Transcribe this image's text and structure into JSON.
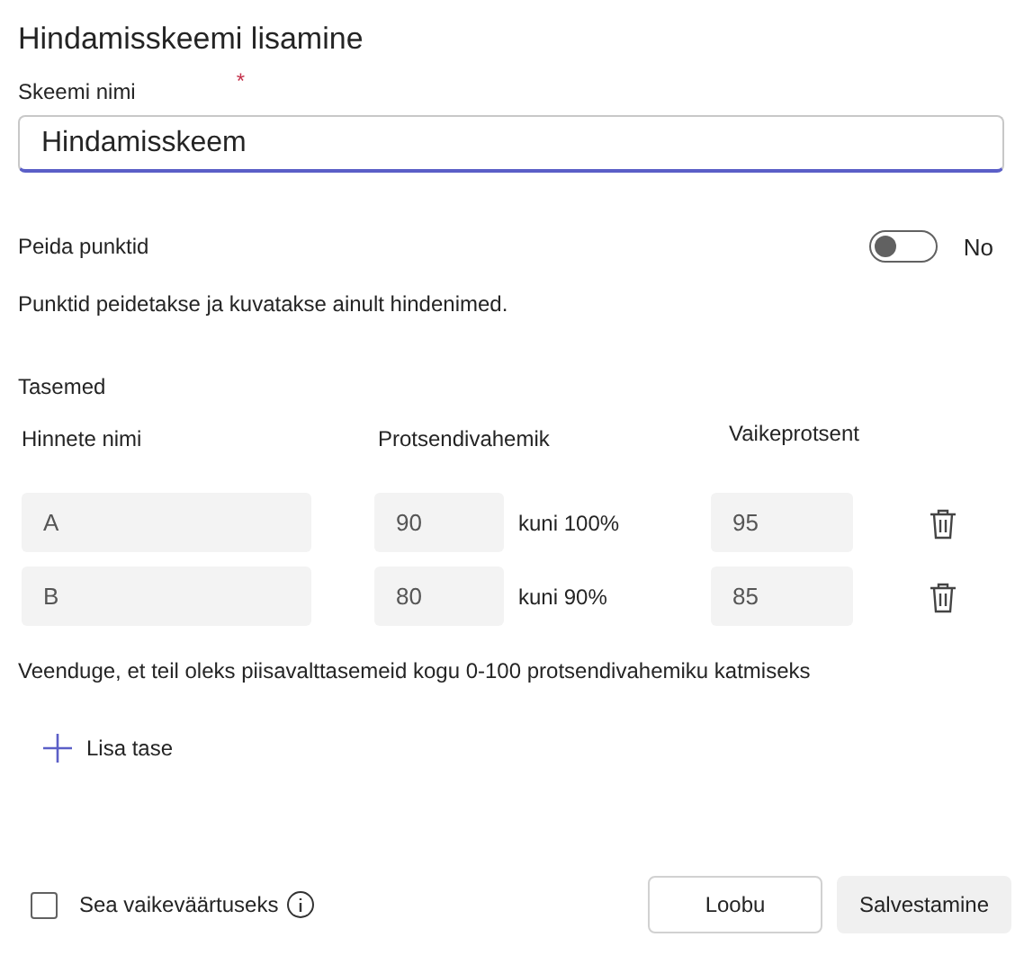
{
  "title": "Hindamisskeemi lisamine",
  "name_field": {
    "label": "Skeemi nimi",
    "required_mark": "*",
    "value": "Hindamisskeem"
  },
  "hide_points": {
    "label": "Peida punktid",
    "on": false,
    "state_text": "No",
    "description": "Punktid peidetakse ja kuvatakse ainult hindenimed."
  },
  "levels": {
    "heading": "Tasemed",
    "columns": [
      "Hinnete nimi",
      "Protsendivahemik",
      "Vaikeprotsent"
    ],
    "rows": [
      {
        "name": "A",
        "from": "90",
        "to": "kuni 100%",
        "default": "95"
      },
      {
        "name": "B",
        "from": "80",
        "to": "kuni 90%",
        "default": "85"
      }
    ],
    "note": "Veenduge, et teil oleks piisavalttasemeid kogu 0-100 protsendivahemiku katmiseks",
    "add": "Lisa tase"
  },
  "footer": {
    "default_checkbox": {
      "label": "Sea vaikeväärtuseks",
      "checked": false
    },
    "buttons": [
      "Loobu",
      "Salvestamine"
    ]
  }
}
